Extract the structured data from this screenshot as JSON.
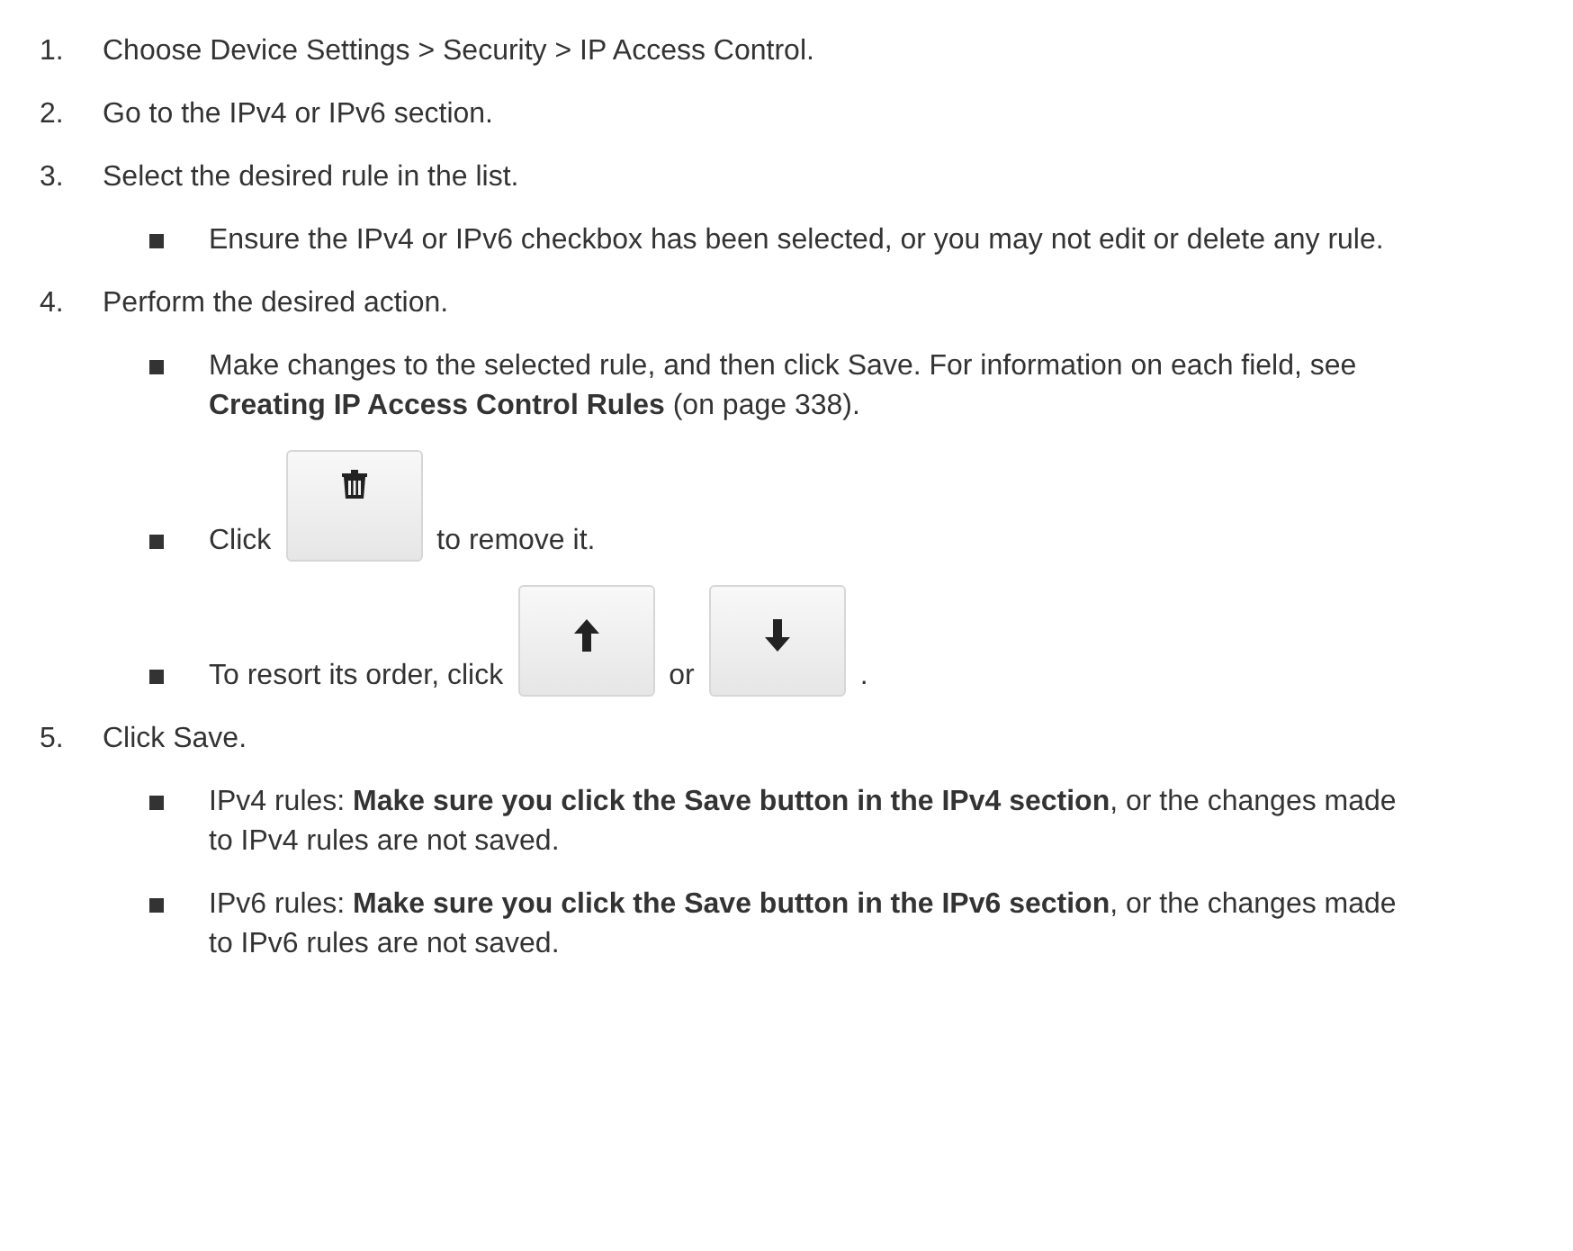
{
  "steps": [
    {
      "number": "1.",
      "text": "Choose Device Settings > Security > IP Access Control."
    },
    {
      "number": "2.",
      "text": "Go to the IPv4 or IPv6 section."
    },
    {
      "number": "3.",
      "text": "Select the desired rule in the list.",
      "bullets": [
        {
          "parts": [
            {
              "kind": "text",
              "text": "Ensure the IPv4 or IPv6 checkbox has been selected, or you may not edit or delete any rule."
            }
          ]
        }
      ]
    },
    {
      "number": "4.",
      "text": "Perform the desired action.",
      "bullets": [
        {
          "parts": [
            {
              "kind": "text",
              "text": "Make changes to the selected rule, and then click Save. For information on each field, see **Creating IP Access Control Rules** (on page 338)."
            }
          ]
        },
        {
          "parts": [
            {
              "kind": "text",
              "text": "Click"
            },
            {
              "kind": "trash"
            },
            {
              "kind": "text",
              "text": "to remove it."
            }
          ]
        },
        {
          "parts": [
            {
              "kind": "text",
              "text": "To resort its order, click"
            },
            {
              "kind": "up"
            },
            {
              "kind": "text",
              "text": "or"
            },
            {
              "kind": "down"
            },
            {
              "kind": "text",
              "text": "."
            }
          ]
        }
      ]
    },
    {
      "number": "5.",
      "text": "Click Save.",
      "bullets": [
        {
          "parts": [
            {
              "kind": "text",
              "text": "IPv4 rules: **Make sure you click the Save button in the IPv4 section**, or the changes made to IPv4 rules are not saved."
            }
          ]
        },
        {
          "parts": [
            {
              "kind": "text",
              "text": "IPv6 rules: **Make sure you click the Save button in the IPv6 section**, or the changes made to IPv6 rules are not saved."
            }
          ]
        }
      ]
    }
  ]
}
